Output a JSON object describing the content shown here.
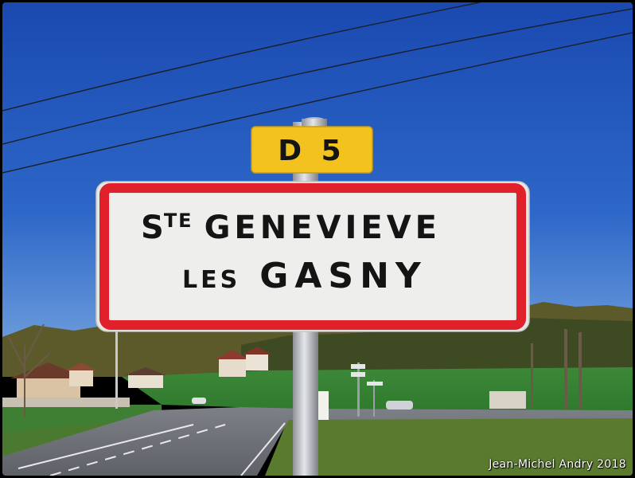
{
  "road_plate": {
    "text": "D 5",
    "color": "#f2c21f"
  },
  "town_sign": {
    "prefix": "S",
    "prefix_superscript": "TE",
    "line1_rest": "GENEVIEVE",
    "line2_small": "LES",
    "line2_large": "GASNY",
    "border_color": "#e0202a",
    "background_color": "#f3f3f1"
  },
  "credit": "Jean-Michel Andry 2018",
  "sky_color": "#1f52b6",
  "field_color": "#3f8a3a"
}
